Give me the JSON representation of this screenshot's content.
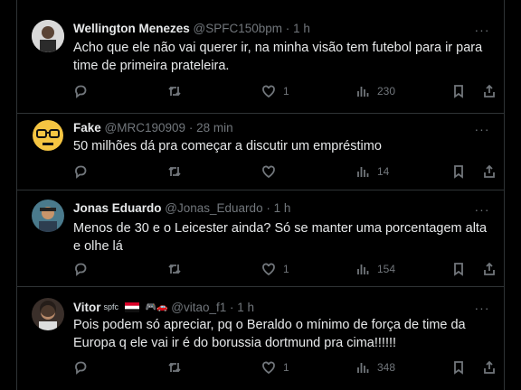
{
  "colors": {
    "background": "#000000",
    "text": "#e7e9ea",
    "muted": "#71767b",
    "border": "#2f3336"
  },
  "tweets": [
    {
      "name": "Wellington Menezes",
      "handle": "@SPFC150bpm",
      "time": "1 h",
      "text": "Acho que ele não vai querer ir, na minha visão tem futebol para ir para time de primeira prateleira.",
      "replies": "",
      "retweets": "",
      "likes": "1",
      "views": "230"
    },
    {
      "name": "Fake",
      "handle": "@MRC190909",
      "time": "28 min",
      "text": "50 milhões dá pra começar a discutir um empréstimo",
      "replies": "",
      "retweets": "",
      "likes": "",
      "views": "14"
    },
    {
      "name": "Jonas Eduardo",
      "handle": "@Jonas_Eduardo",
      "time": "1 h",
      "text": "Menos de 30 e o Leicester ainda? Só se manter uma porcentagem alta e olhe lá",
      "replies": "",
      "retweets": "",
      "likes": "1",
      "views": "154"
    },
    {
      "name": "Vitor",
      "name_badge": "spfc",
      "handle": "@vitao_f1",
      "time": "1 h",
      "text": "Pois podem só apreciar, pq o Beraldo o mínimo de força de time da Europa q ele vai ir é do borussia dortmund pra cima!!!!!!",
      "replies": "",
      "retweets": "",
      "likes": "1",
      "views": "348"
    }
  ],
  "separator": "·",
  "more_label": "···"
}
